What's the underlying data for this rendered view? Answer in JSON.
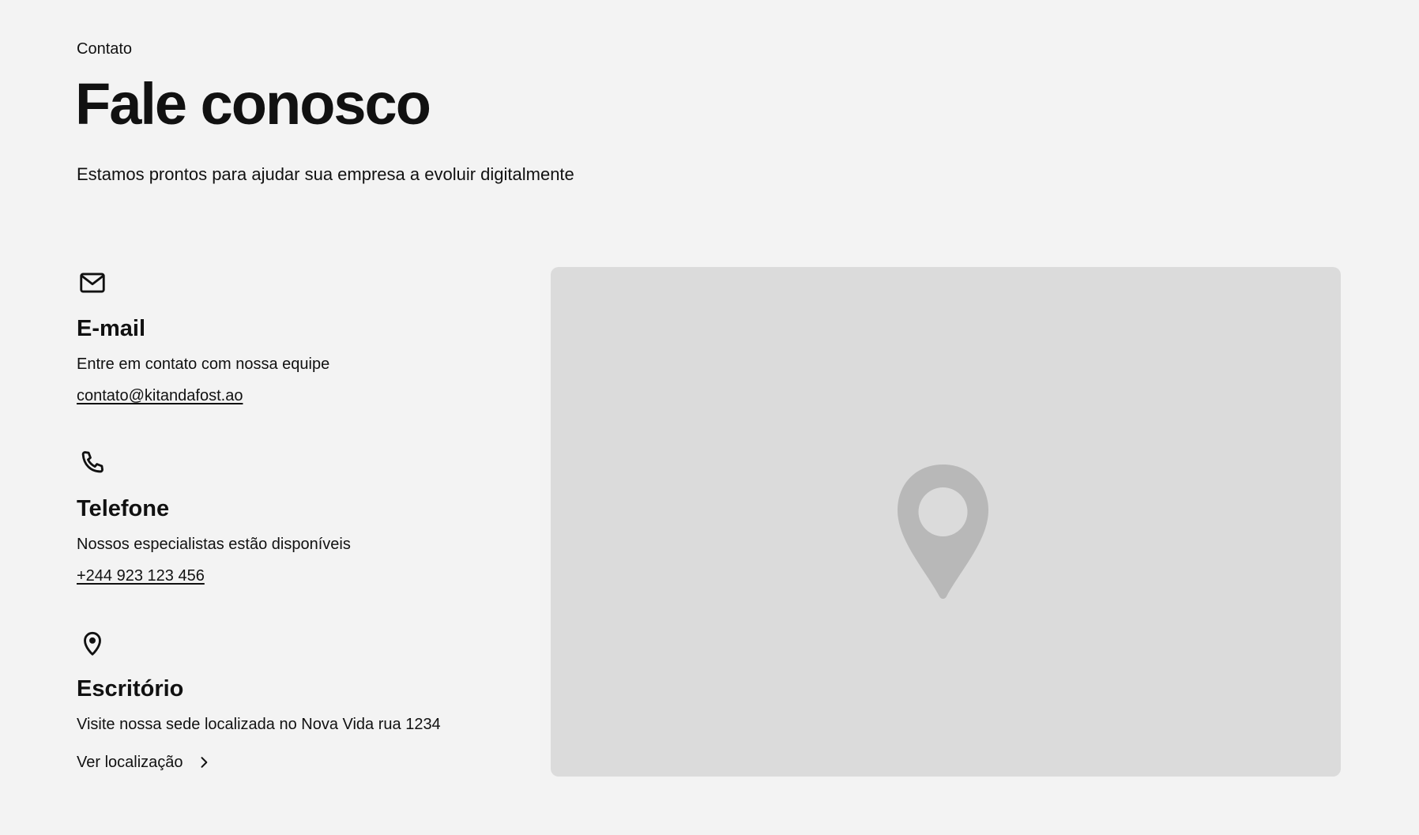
{
  "header": {
    "eyebrow": "Contato",
    "title": "Fale conosco",
    "subtitle": "Estamos prontos para ajudar sua empresa a evoluir digitalmente"
  },
  "contacts": {
    "email": {
      "icon": "mail-icon",
      "title": "E-mail",
      "description": "Entre em contato com nossa equipe",
      "link": "contato@kitandafost.ao"
    },
    "phone": {
      "icon": "phone-icon",
      "title": "Telefone",
      "description": "Nossos especialistas estão disponíveis",
      "link": "+244 923 123 456"
    },
    "office": {
      "icon": "map-pin-icon",
      "title": "Escritório",
      "description": "Visite nossa sede localizada no Nova Vida rua 1234",
      "link": "Ver localização",
      "link_icon": "chevron-right-icon"
    }
  },
  "map": {
    "icon": "location-pin-icon",
    "placeholder_color": "#dbdbdb",
    "pin_color": "#b8b8b8"
  },
  "colors": {
    "background": "#f3f3f3",
    "text": "#111111"
  }
}
